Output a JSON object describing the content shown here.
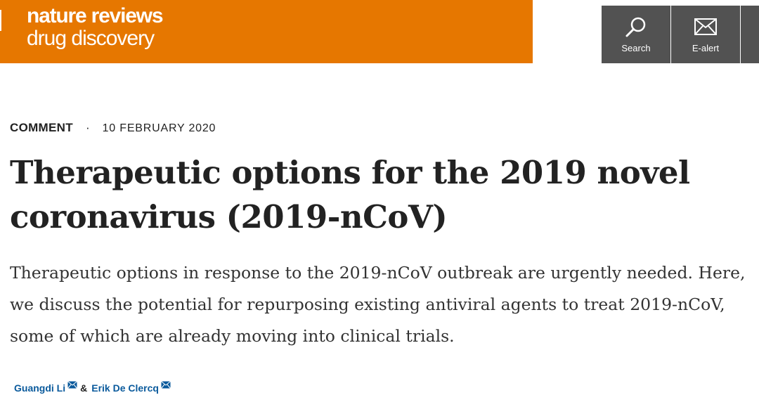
{
  "header": {
    "brand_line1": "nature reviews",
    "brand_line2": "drug discovery",
    "brand_color": "#e67700",
    "buttons": [
      {
        "label": "Search",
        "icon": "search-icon"
      },
      {
        "label": "E-alert",
        "icon": "envelope-icon"
      }
    ]
  },
  "article": {
    "type": "COMMENT",
    "separator": "·",
    "date": "10 FEBRUARY 2020",
    "title": "Therapeutic options for the 2019 novel coronavirus (2019-nCoV)",
    "standfirst": "Therapeutic options in response to the 2019-nCoV outbreak are urgently needed. Here, we discuss the potential for repurposing existing antiviral agents to treat 2019-nCoV, some of which are already moving into clinical trials.",
    "authors": [
      {
        "name": "Guangdi Li"
      },
      {
        "name": "Erik De Clercq"
      }
    ],
    "author_separator": "&"
  }
}
